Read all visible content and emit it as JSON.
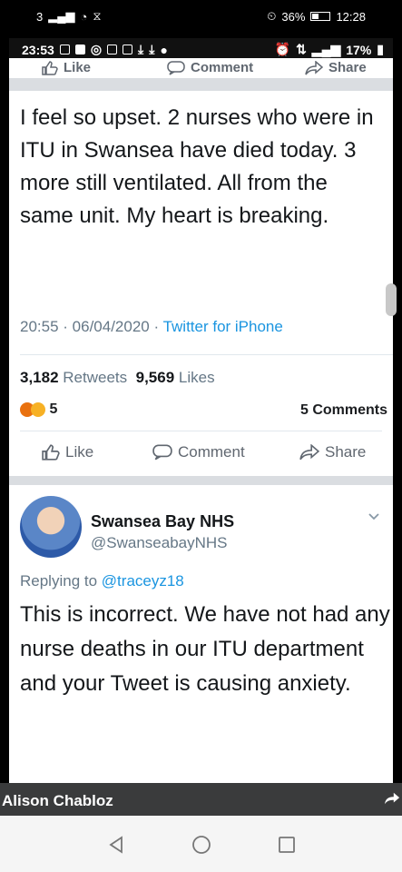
{
  "outer_status": {
    "left": "3",
    "battery": "36%",
    "time": "12:28"
  },
  "inner_status": {
    "time": "23:53",
    "battery": "17%"
  },
  "fb_top_actions": {
    "like": "Like",
    "comment": "Comment",
    "share": "Share"
  },
  "tweet": {
    "text": "I feel so upset. 2 nurses who were in ITU in Swansea have died today. 3 more still ventilated. All from the same unit. My heart is breaking.",
    "time": "20:55",
    "date": "06/04/2020",
    "source": "Twitter for iPhone",
    "retweets_count": "3,182",
    "retweets_label": "Retweets",
    "likes_count": "9,569",
    "likes_label": "Likes"
  },
  "fb_post": {
    "reactions_count": "5",
    "comments": "5 Comments",
    "like": "Like",
    "comment": "Comment",
    "share": "Share"
  },
  "reply": {
    "name": "Swansea Bay NHS",
    "handle": "@SwanseabayNHS",
    "replying_prefix": "Replying to",
    "replying_handle": "@traceyz18",
    "text": "This is incorrect. We have not had any nurse deaths in our ITU department and your Tweet is causing anxiety."
  },
  "fb_user": {
    "name": "Alison Chabloz"
  },
  "colors": {
    "twitter_blue": "#1b95e0",
    "fb_gray": "#606770",
    "text": "#14171a"
  }
}
